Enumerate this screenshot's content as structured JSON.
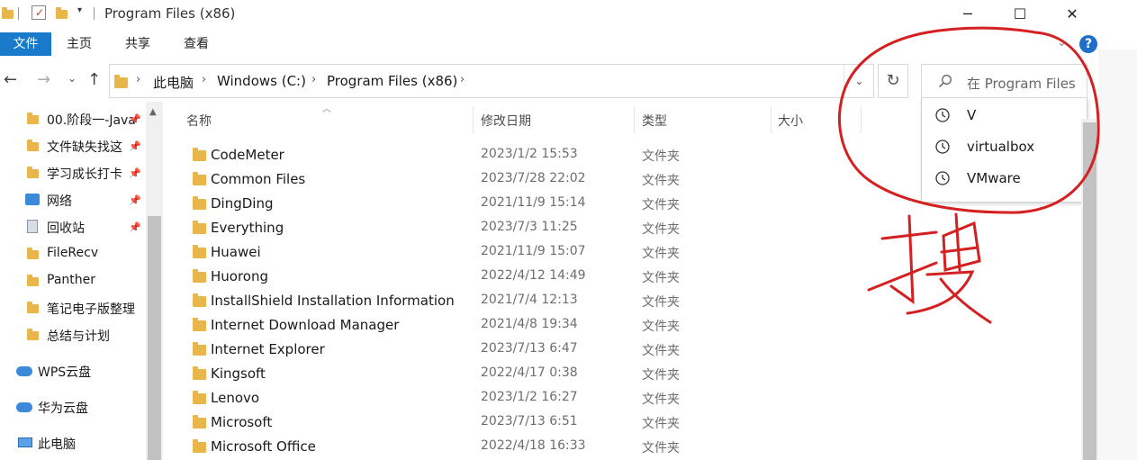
{
  "window": {
    "title": "Program Files (x86)",
    "minimize": "─",
    "maximize": "☐",
    "close": "✕"
  },
  "ribbon": {
    "file": "文件",
    "tabs": [
      "主页",
      "共享",
      "查看"
    ],
    "help": "?"
  },
  "nav": {
    "back": "←",
    "forward": "→",
    "recent": "⌄",
    "up": "↑",
    "breadcrumbs": [
      "此电脑",
      "Windows (C:)",
      "Program Files (x86)"
    ],
    "separator": "›",
    "refresh": "↻",
    "dropdown": "⌄"
  },
  "search": {
    "placeholder": "在 Program Files",
    "history": [
      "V",
      "virtualbox",
      "VMware"
    ]
  },
  "annotation": {
    "handwritten_char": "搜",
    "color": "#d42020"
  },
  "sidebar": {
    "items": [
      {
        "label": "00.阶段一-Java",
        "icon": "folder-icon",
        "pinned": true
      },
      {
        "label": "文件缺失找这",
        "icon": "folder-icon",
        "pinned": true
      },
      {
        "label": "学习成长打卡",
        "icon": "folder-icon",
        "pinned": true
      },
      {
        "label": "网络",
        "icon": "network-icon",
        "pinned": true
      },
      {
        "label": "回收站",
        "icon": "recycle-bin-icon",
        "pinned": true
      },
      {
        "label": "FileRecv",
        "icon": "folder-icon",
        "pinned": false
      },
      {
        "label": "Panther",
        "icon": "folder-special-icon",
        "pinned": false
      },
      {
        "label": "笔记电子版整理",
        "icon": "folder-icon",
        "pinned": false
      },
      {
        "label": "总结与计划",
        "icon": "folder-icon",
        "pinned": false
      }
    ],
    "cloud": [
      {
        "label": "WPS云盘",
        "icon": "cloud-icon"
      },
      {
        "label": "华为云盘",
        "icon": "cloud-icon"
      }
    ],
    "this_pc": "此电脑"
  },
  "columns": {
    "name": "名称",
    "modified": "修改日期",
    "type": "类型",
    "size": "大小"
  },
  "files": [
    {
      "name": "CodeMeter",
      "date": "2023/1/2 15:53",
      "type": "文件夹"
    },
    {
      "name": "Common Files",
      "date": "2023/7/28 22:02",
      "type": "文件夹"
    },
    {
      "name": "DingDing",
      "date": "2021/11/9 15:14",
      "type": "文件夹"
    },
    {
      "name": "Everything",
      "date": "2023/7/3 11:25",
      "type": "文件夹"
    },
    {
      "name": "Huawei",
      "date": "2021/11/9 15:07",
      "type": "文件夹"
    },
    {
      "name": "Huorong",
      "date": "2022/4/12 14:49",
      "type": "文件夹"
    },
    {
      "name": "InstallShield Installation Information",
      "date": "2021/7/4 12:13",
      "type": "文件夹"
    },
    {
      "name": "Internet Download Manager",
      "date": "2021/4/8 19:34",
      "type": "文件夹"
    },
    {
      "name": "Internet Explorer",
      "date": "2023/7/13 6:47",
      "type": "文件夹"
    },
    {
      "name": "Kingsoft",
      "date": "2022/4/17 0:38",
      "type": "文件夹"
    },
    {
      "name": "Lenovo",
      "date": "2023/1/2 16:27",
      "type": "文件夹"
    },
    {
      "name": "Microsoft",
      "date": "2023/7/13 6:51",
      "type": "文件夹"
    },
    {
      "name": "Microsoft Office",
      "date": "2022/4/18 16:33",
      "type": "文件夹"
    }
  ]
}
